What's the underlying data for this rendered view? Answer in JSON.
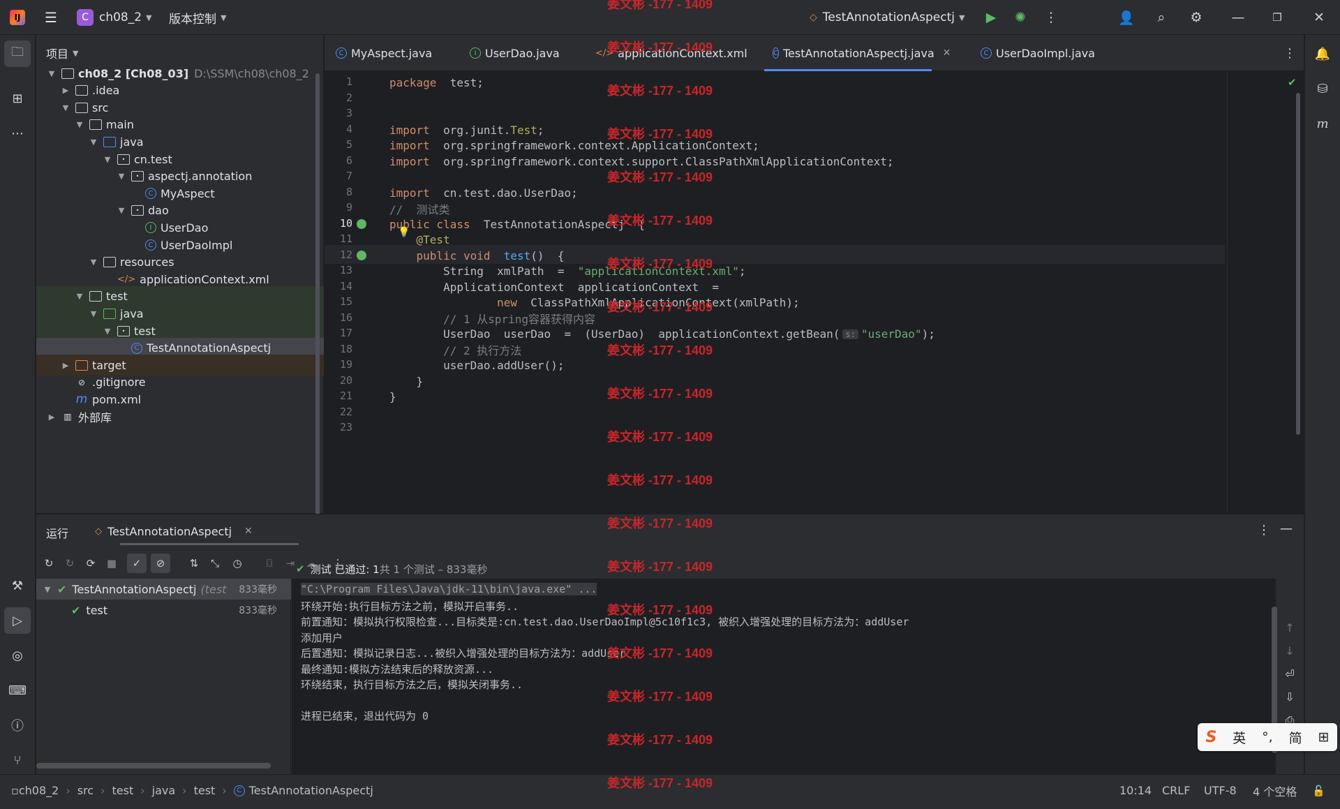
{
  "titlebar": {
    "project_badge": "C",
    "project_name": "ch08_2",
    "vcs_label": "版本控制",
    "run_config": "TestAnnotationAspectj"
  },
  "project_panel": {
    "title": "项目",
    "tree": [
      {
        "label": "ch08_2 [Ch08_03]",
        "extra": "D:\\SSM\\ch08\\ch08_2",
        "kind": "module",
        "depth": 0,
        "open": true
      },
      {
        "label": ".idea",
        "kind": "folder",
        "depth": 1,
        "open": false
      },
      {
        "label": "src",
        "kind": "folder",
        "depth": 1,
        "open": true
      },
      {
        "label": "main",
        "kind": "folder",
        "depth": 2,
        "open": true
      },
      {
        "label": "java",
        "kind": "srcfolder",
        "depth": 3,
        "open": true
      },
      {
        "label": "cn.test",
        "kind": "package",
        "depth": 4,
        "open": true
      },
      {
        "label": "aspectj.annotation",
        "kind": "package",
        "depth": 5,
        "open": true
      },
      {
        "label": "MyAspect",
        "kind": "class",
        "depth": 6
      },
      {
        "label": "dao",
        "kind": "package",
        "depth": 5,
        "open": true
      },
      {
        "label": "UserDao",
        "kind": "interface",
        "depth": 6
      },
      {
        "label": "UserDaoImpl",
        "kind": "class",
        "depth": 6
      },
      {
        "label": "resources",
        "kind": "resfolder",
        "depth": 3,
        "open": true
      },
      {
        "label": "applicationContext.xml",
        "kind": "xml",
        "depth": 4
      },
      {
        "label": "test",
        "kind": "folder",
        "depth": 2,
        "open": true
      },
      {
        "label": "java",
        "kind": "testfolder",
        "depth": 3,
        "open": true
      },
      {
        "label": "test",
        "kind": "package",
        "depth": 4,
        "open": true
      },
      {
        "label": "TestAnnotationAspectj",
        "kind": "class",
        "depth": 5,
        "selected": true
      },
      {
        "label": "target",
        "kind": "excluded",
        "depth": 1,
        "open": false
      },
      {
        "label": ".gitignore",
        "kind": "ignore",
        "depth": 1
      },
      {
        "label": "pom.xml",
        "kind": "maven",
        "depth": 1
      },
      {
        "label": "外部库",
        "kind": "library",
        "depth": 0,
        "open": false
      }
    ]
  },
  "tabs": [
    {
      "label": "MyAspect.java",
      "icon": "class"
    },
    {
      "label": "UserDao.java",
      "icon": "interface"
    },
    {
      "label": "applicationContext.xml",
      "icon": "xml"
    },
    {
      "label": "TestAnnotationAspectj.java",
      "icon": "class",
      "active": true
    },
    {
      "label": "UserDaoImpl.java",
      "icon": "class"
    }
  ],
  "editor": {
    "cursor_line": 10,
    "lines": [
      [
        [
          "kw",
          "package"
        ],
        [
          "",
          "  test;"
        ]
      ],
      [],
      [],
      [
        [
          "kw",
          "import"
        ],
        [
          "",
          "  org.junit."
        ],
        [
          "ann",
          "Test"
        ],
        [
          "",
          ";"
        ]
      ],
      [
        [
          "kw",
          "import"
        ],
        [
          "",
          "  org.springframework.context.ApplicationContext;"
        ]
      ],
      [
        [
          "kw",
          "import"
        ],
        [
          "",
          "  org.springframework.context.support.ClassPathXmlApplicationContext;"
        ]
      ],
      [],
      [
        [
          "kw",
          "import"
        ],
        [
          "",
          "  cn.test.dao.UserDao;"
        ]
      ],
      [
        [
          "cm",
          "//  测试类"
        ]
      ],
      [
        [
          "kw",
          "public class"
        ],
        [
          "",
          "  TestAnnotationAspectj  {"
        ]
      ],
      [
        [
          "ann",
          "    @Test"
        ]
      ],
      [
        [
          "kw",
          "    public void"
        ],
        [
          "",
          "  "
        ],
        [
          "fn",
          "test"
        ],
        [
          "",
          "()  {"
        ]
      ],
      [
        [
          "",
          "        String  xmlPath  =  "
        ],
        [
          "str",
          "\"applicationContext.xml\""
        ],
        [
          "",
          ";"
        ]
      ],
      [
        [
          "",
          "        ApplicationContext  applicationContext  ="
        ]
      ],
      [
        [
          "kw",
          "                new"
        ],
        [
          "",
          "  ClassPathXmlApplicationContext(xmlPath);"
        ]
      ],
      [
        [
          "cm",
          "        // 1 从spring容器获得内容"
        ]
      ],
      [
        [
          "",
          "        UserDao  userDao  =  (UserDao)  applicationContext.getBean("
        ],
        [
          "hint",
          "s:"
        ],
        [
          "str",
          "\"userDao\""
        ],
        [
          "",
          ");"
        ]
      ],
      [
        [
          "cm",
          "        // 2 执行方法"
        ]
      ],
      [
        [
          "",
          "        userDao.addUser();"
        ]
      ],
      [
        [
          "",
          "    }"
        ]
      ],
      [
        [
          "",
          "}"
        ]
      ],
      [],
      []
    ]
  },
  "run_panel": {
    "title": "运行",
    "tab_label": "TestAnnotationAspectj",
    "tree": [
      {
        "label": "TestAnnotationAspectj",
        "extra": "(test",
        "time": "833毫秒",
        "depth": 0,
        "selected": true
      },
      {
        "label": "test",
        "time": "833毫秒",
        "depth": 1
      }
    ],
    "status_prefix": "测试 已通过: 1",
    "status_suffix": "共 1 个测试 – 833毫秒",
    "console": [
      "\"C:\\Program Files\\Java\\jdk-11\\bin\\java.exe\" ...",
      "环绕开始:执行目标方法之前，模拟开启事务..",
      "前置通知：模拟执行权限检查...目标类是:cn.test.dao.UserDaoImpl@5c10f1c3, 被织入增强处理的目标方法为：addUser",
      "添加用户",
      "后置通知：模拟记录日志...被织入增强处理的目标方法为：addUser",
      "最终通知:模拟方法结束后的释放资源...",
      "环绕结束，执行目标方法之后，模拟关闭事务..",
      "",
      "进程已结束，退出代码为 0"
    ]
  },
  "statusbar": {
    "breadcrumbs": [
      "ch08_2",
      "src",
      "test",
      "java",
      "test",
      "TestAnnotationAspectj"
    ],
    "position": "10:14",
    "line_sep": "CRLF",
    "encoding": "UTF-8",
    "indent": "4 个空格"
  },
  "watermark": "姜文彬 -177 - 1409",
  "ime": {
    "s": "S",
    "lang": "英",
    "mode1": "‹",
    "script": "简",
    "grid": "⊞"
  }
}
